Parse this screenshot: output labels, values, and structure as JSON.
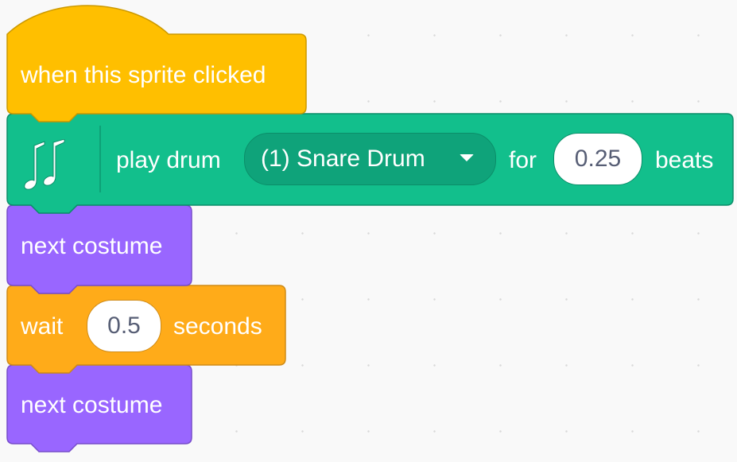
{
  "colors": {
    "events": "#ffbf00",
    "music": "#12bf8c",
    "looks": "#9966ff",
    "control": "#ffab19",
    "workspace": "#f9f9f9"
  },
  "blocks": {
    "hat": {
      "label": "when this sprite clicked",
      "category": "events"
    },
    "play_drum": {
      "icon": "music-notes-icon",
      "label": "play drum",
      "drum": "(1) Snare Drum",
      "for_label": "for",
      "beats_value": "0.25",
      "beats_label": "beats",
      "category": "music"
    },
    "next_costume_1": {
      "label": "next costume",
      "category": "looks"
    },
    "wait": {
      "label": "wait",
      "value": "0.5",
      "unit": "seconds",
      "category": "control"
    },
    "next_costume_2": {
      "label": "next costume",
      "category": "looks"
    }
  }
}
